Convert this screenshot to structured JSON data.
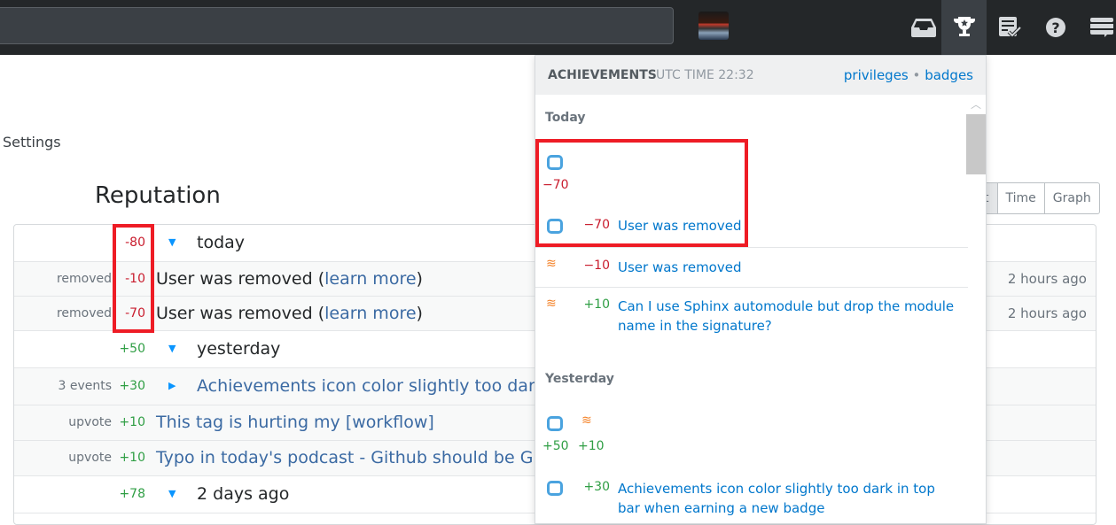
{
  "topbar": {
    "icons": [
      "inbox-icon",
      "trophy-icon",
      "review-icon",
      "help-icon",
      "site-switcher-icon"
    ]
  },
  "page": {
    "settings": "Settings",
    "title": "Reputation"
  },
  "view_buttons": [
    "t",
    "Time",
    "Graph"
  ],
  "reputation": {
    "rows": [
      {
        "type": "group",
        "amount": "-80",
        "sign": "neg",
        "caret": "▼",
        "title": "today"
      },
      {
        "type": "event",
        "label": "removed",
        "amount": "-10",
        "sign": "neg",
        "text": "User was removed (",
        "link": "learn more",
        "after": ")",
        "ago": "2 hours ago"
      },
      {
        "type": "event",
        "label": "removed",
        "amount": "-70",
        "sign": "neg",
        "text": "User was removed (",
        "link": "learn more",
        "after": ")",
        "ago": "2 hours ago"
      },
      {
        "type": "group",
        "amount": "+50",
        "sign": "pos",
        "caret": "▼",
        "title": "yesterday"
      },
      {
        "type": "event",
        "label": "3 events",
        "amount": "+30",
        "sign": "pos",
        "caret": "▶",
        "link": "Achievements icon color slightly too dark in top bar when earning a new badge"
      },
      {
        "type": "event",
        "label": "upvote",
        "amount": "+10",
        "sign": "pos",
        "link": "This tag is hurting my [workflow]"
      },
      {
        "type": "event",
        "label": "upvote",
        "amount": "+10",
        "sign": "pos",
        "link": "Typo in today's podcast - Github should be GitHub"
      },
      {
        "type": "group",
        "amount": "+78",
        "sign": "pos",
        "caret": "▼",
        "title": "2 days ago"
      }
    ]
  },
  "achievements": {
    "title": "ACHIEVEMENTS",
    "utc": "UTC TIME 22:32",
    "privileges": "privileges",
    "sep": "•",
    "badges": "badges",
    "today_label": "Today",
    "today_summary": {
      "icon": "meta-bubble-icon",
      "amount": "−70"
    },
    "today_items": [
      {
        "icon": "meta-bubble-icon",
        "amount": "−70",
        "sign": "neg",
        "text": "User was removed"
      },
      {
        "icon": "stackoverflow-icon",
        "amount": "−10",
        "sign": "neg",
        "text": "User was removed"
      },
      {
        "icon": "stackoverflow-icon",
        "amount": "+10",
        "sign": "pos",
        "text": "Can I use Sphinx automodule but drop the module name in the signature?"
      }
    ],
    "yesterday_label": "Yesterday",
    "yesterday_summary": [
      {
        "icon": "meta-bubble-icon",
        "amount": "+50"
      },
      {
        "icon": "stackoverflow-icon",
        "amount": "+10"
      }
    ],
    "yesterday_items": [
      {
        "icon": "meta-bubble-icon",
        "amount": "+30",
        "sign": "pos",
        "text": "Achievements icon color slightly too dark in top bar when earning a new badge"
      }
    ]
  },
  "colors": {
    "topbar": "#242729",
    "negative": "#c91d2e",
    "positive": "#2f9e44",
    "link": "#0077cc",
    "highlight": "#ee1c25"
  }
}
